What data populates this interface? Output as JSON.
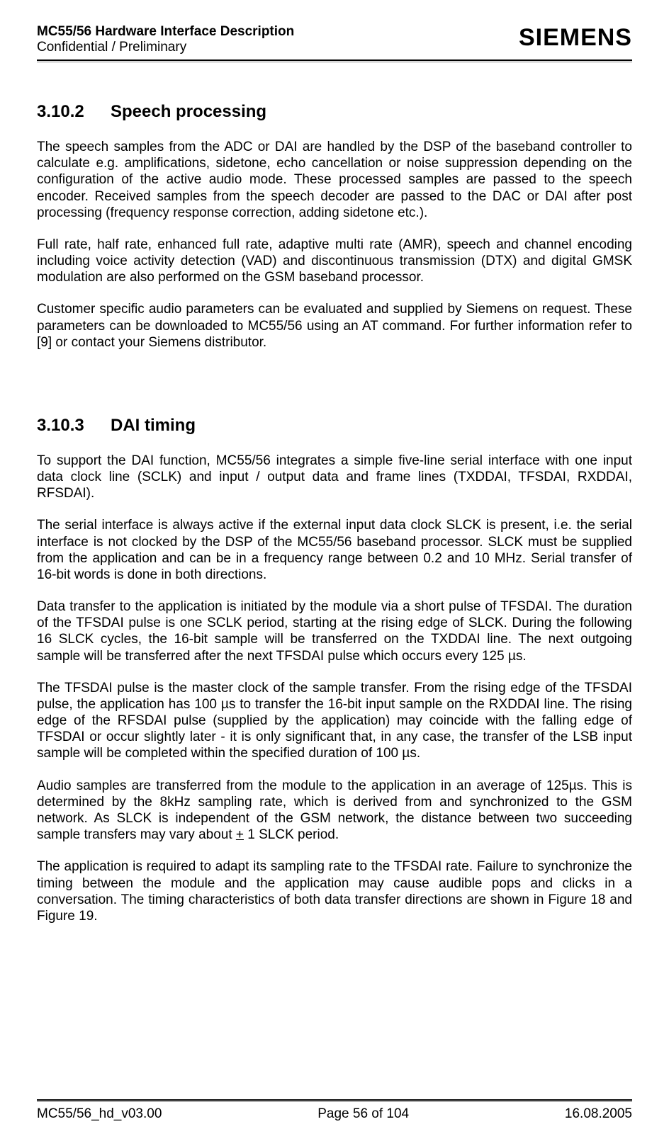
{
  "header": {
    "title": "MC55/56 Hardware Interface Description",
    "subtitle": "Confidential / Preliminary",
    "logo": "SIEMENS"
  },
  "sections": {
    "s1": {
      "number": "3.10.2",
      "title": "Speech processing",
      "p1": "The speech samples from the ADC or DAI are handled by the DSP of the baseband controller to calculate e.g. amplifications, sidetone, echo cancellation or noise suppression depending on the configuration of the active audio mode. These processed samples are passed to the speech encoder. Received samples from the speech decoder are passed to the DAC or DAI after post processing (frequency response correction, adding sidetone etc.).",
      "p2": "Full rate, half rate, enhanced full rate, adaptive multi rate (AMR), speech and channel encoding including voice activity detection (VAD) and discontinuous transmission (DTX) and digital GMSK modulation are also performed on the GSM baseband processor.",
      "p3": "Customer specific audio parameters can be evaluated and supplied by Siemens on request. These parameters can be downloaded to MC55/56 using an AT command. For further information refer to [9] or contact your Siemens distributor."
    },
    "s2": {
      "number": "3.10.3",
      "title": "DAI timing",
      "p1": "To support the DAI function, MC55/56 integrates a simple five-line serial interface with one input data clock line (SCLK) and input / output data and frame lines (TXDDAI, TFSDAI, RXDDAI, RFSDAI).",
      "p2": "The serial interface is always active if the external input data clock SLCK is present, i.e. the serial interface is not clocked by the DSP of the MC55/56 baseband processor. SLCK must be supplied from the application and can be in a frequency range between 0.2 and 10 MHz. Serial transfer of 16-bit words is done in both directions.",
      "p3": "Data transfer to the application is initiated by the module via a short pulse of TFSDAI. The duration of the TFSDAI pulse is one SCLK period, starting at the rising edge of SLCK. During the following 16 SLCK cycles, the 16-bit sample will be transferred on the TXDDAI line. The next outgoing sample will be transferred after the next TFSDAI pulse which occurs every 125 µs.",
      "p4": "The TFSDAI pulse is the master clock of the sample transfer. From the rising edge of the TFSDAI pulse, the application has 100 µs to transfer the 16-bit input sample on the RXDDAI line. The rising edge of the RFSDAI pulse (supplied by the application) may coincide with the falling edge of TFSDAI or occur slightly later - it is only significant that, in any case, the transfer of the LSB input sample will be completed within the specified duration of 100 µs.",
      "p5a": "Audio samples are transferred from the module to the application in an average of 125µs. This is determined by the 8kHz sampling rate, which is derived from and synchronized to the GSM network. As SLCK is independent of the GSM network, the distance between two succeeding sample transfers may vary about ",
      "p5u": "+",
      "p5b": " 1 SLCK period.",
      "p6": "The application is required to adapt its sampling rate to the TFSDAI rate. Failure to synchronize the timing between the module and the application may cause audible pops and clicks in a conversation. The timing characteristics of both data transfer directions are shown in Figure 18 and Figure 19."
    }
  },
  "footer": {
    "left": "MC55/56_hd_v03.00",
    "center": "Page 56 of 104",
    "right": "16.08.2005"
  }
}
